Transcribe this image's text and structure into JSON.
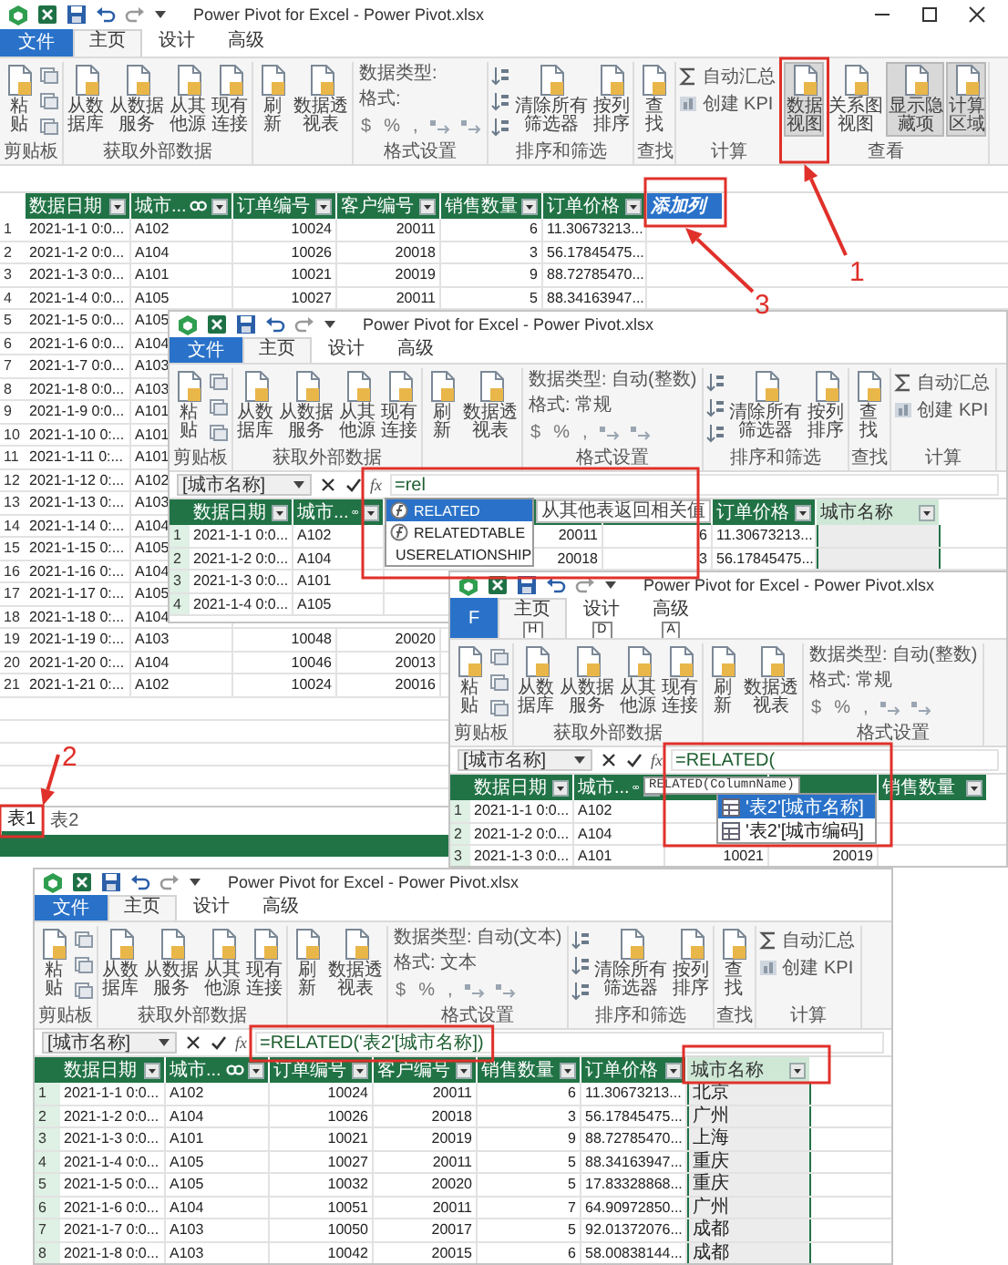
{
  "windows": [
    {
      "title": "Power Pivot for Excel - Power Pivot.xlsx",
      "window_controls": true,
      "tabs": [
        {
          "kind": "file",
          "label": "文件",
          "selected": false
        },
        {
          "label": "主页",
          "selected": true
        },
        {
          "label": "设计",
          "selected": false
        },
        {
          "label": "高级",
          "selected": false
        }
      ],
      "ribbon": [
        {
          "label": "剪贴板",
          "items": [
            {
              "kind": "large",
              "label": "粘贴"
            },
            {
              "kind": "icons"
            }
          ]
        },
        {
          "label": "获取外部数据",
          "items": [
            {
              "kind": "large",
              "label": "从数据库"
            },
            {
              "kind": "large",
              "label": "从数据服务"
            },
            {
              "kind": "large",
              "label": "从其他源"
            },
            {
              "kind": "large",
              "label": "现有连接"
            }
          ]
        },
        {
          "items": [
            {
              "kind": "large",
              "label": "刷新"
            },
            {
              "kind": "large",
              "label": "数据透视表"
            }
          ]
        },
        {
          "label": "格式设置",
          "items": [
            {
              "kind": "fields",
              "lines": [
                "数据类型:",
                "格式:"
              ],
              "symbols": [
                "$",
                "%",
                ","
              ]
            }
          ]
        },
        {
          "label": "排序和筛选",
          "items": [
            {
              "kind": "sort"
            },
            {
              "kind": "large",
              "label": "清除所有筛选器"
            },
            {
              "kind": "large",
              "label": "按列排序"
            }
          ]
        },
        {
          "label": "查找",
          "items": [
            {
              "kind": "large",
              "label": "查找"
            }
          ]
        },
        {
          "label": "计算",
          "items": [
            {
              "kind": "small",
              "labels": [
                "自动汇总",
                "创建 KPI"
              ]
            }
          ]
        },
        {
          "label": "查看",
          "items": [
            {
              "kind": "large",
              "label": "数据视图",
              "pressed": true
            },
            {
              "kind": "large",
              "label": "关系图视图",
              "pressed": false
            },
            {
              "kind": "large",
              "label": "显示隐藏项",
              "pressed": true
            },
            {
              "kind": "large",
              "label": "计算区域",
              "pressed": true
            }
          ]
        }
      ],
      "grid": {
        "columns": [
          {
            "label": "数据日期",
            "selected": false
          },
          {
            "label": "城市...",
            "kind": "related",
            "selected": false
          },
          {
            "label": "订单编号",
            "selected": false
          },
          {
            "label": "客户编号",
            "selected": false
          },
          {
            "label": "销售数量",
            "selected": false
          },
          {
            "label": "订单价格",
            "selected": false
          },
          {
            "label": "添加列",
            "kind": "add",
            "selected": true
          }
        ],
        "rows": [
          {
            "number": "1",
            "cells": [
              "2021-1-1 0:0...",
              "A102",
              "10024",
              "20011",
              "6",
              "11.30673213..."
            ]
          },
          {
            "number": "2",
            "cells": [
              "2021-1-2 0:0...",
              "A104",
              "10026",
              "20018",
              "3",
              "56.17845475..."
            ]
          },
          {
            "number": "3",
            "cells": [
              "2021-1-3 0:0...",
              "A101",
              "10021",
              "20019",
              "9",
              "88.72785470..."
            ]
          },
          {
            "number": "4",
            "cells": [
              "2021-1-4 0:0...",
              "A105",
              "10027",
              "20011",
              "5",
              "88.34163947..."
            ]
          },
          {
            "number": "5",
            "cells": [
              "2021-1-5 0:0...",
              "A105"
            ]
          },
          {
            "number": "6",
            "cells": [
              "2021-1-6 0:0...",
              "A104"
            ]
          },
          {
            "number": "7",
            "cells": [
              "2021-1-7 0:0...",
              "A103"
            ]
          },
          {
            "number": "8",
            "cells": [
              "2021-1-8 0:0...",
              "A103"
            ]
          },
          {
            "number": "9",
            "cells": [
              "2021-1-9 0:0...",
              "A101"
            ]
          },
          {
            "number": "10",
            "cells": [
              "2021-1-10 0:...",
              "A101"
            ]
          },
          {
            "number": "11",
            "cells": [
              "2021-1-11 0:...",
              "A101"
            ]
          },
          {
            "number": "12",
            "cells": [
              "2021-1-12 0:...",
              "A102"
            ]
          },
          {
            "number": "13",
            "cells": [
              "2021-1-13 0:...",
              "A103"
            ]
          },
          {
            "number": "14",
            "cells": [
              "2021-1-14 0:...",
              "A104"
            ]
          },
          {
            "number": "15",
            "cells": [
              "2021-1-15 0:...",
              "A105"
            ]
          },
          {
            "number": "16",
            "cells": [
              "2021-1-16 0:...",
              "A104"
            ]
          },
          {
            "number": "17",
            "cells": [
              "2021-1-17 0:...",
              "A105"
            ]
          },
          {
            "number": "18",
            "cells": [
              "2021-1-18 0:...",
              "A104"
            ]
          },
          {
            "number": "19",
            "cells": [
              "2021-1-19 0:...",
              "A103",
              "10048",
              "20020"
            ]
          },
          {
            "number": "20",
            "cells": [
              "2021-1-20 0:...",
              "A104",
              "10046",
              "20013"
            ]
          },
          {
            "number": "21",
            "cells": [
              "2021-1-21 0:...",
              "A102",
              "10024",
              "20016"
            ]
          }
        ]
      },
      "sheet_tabs": [
        {
          "label": "表1",
          "selected": true
        },
        {
          "label": "表2",
          "selected": false
        }
      ]
    },
    {
      "title": "Power Pivot for Excel - Power Pivot.xlsx",
      "tabs": [
        {
          "kind": "file",
          "label": "文件",
          "selected": false
        },
        {
          "label": "主页",
          "selected": true
        },
        {
          "label": "设计",
          "selected": false
        },
        {
          "label": "高级",
          "selected": false
        }
      ],
      "ribbon": [
        {
          "label": "剪贴板",
          "items": [
            {
              "kind": "large",
              "label": "粘贴"
            },
            {
              "kind": "icons"
            }
          ]
        },
        {
          "label": "获取外部数据",
          "items": [
            {
              "kind": "large",
              "label": "从数据库"
            },
            {
              "kind": "large",
              "label": "从数据服务"
            },
            {
              "kind": "large",
              "label": "从其他源"
            },
            {
              "kind": "large",
              "label": "现有连接"
            }
          ]
        },
        {
          "items": [
            {
              "kind": "large",
              "label": "刷新"
            },
            {
              "kind": "large",
              "label": "数据透视表"
            }
          ]
        },
        {
          "label": "格式设置",
          "items": [
            {
              "kind": "fields",
              "lines": [
                "数据类型: 自动(整数)",
                "格式: 常规"
              ],
              "symbols": [
                "$",
                "%",
                ","
              ]
            }
          ]
        },
        {
          "label": "排序和筛选",
          "items": [
            {
              "kind": "sort"
            },
            {
              "kind": "large",
              "label": "清除所有筛选器"
            },
            {
              "kind": "large",
              "label": "按列排序"
            }
          ]
        },
        {
          "label": "查找",
          "items": [
            {
              "kind": "large",
              "label": "查找"
            }
          ]
        },
        {
          "label": "计算",
          "items": [
            {
              "kind": "small",
              "labels": [
                "自动汇总",
                "创建 KPI"
              ]
            }
          ]
        }
      ],
      "formula_bar": {
        "name_box": "[城市名称]",
        "function_symbol": "fx",
        "formula": "=rel"
      },
      "autocomplete": {
        "tooltip": "从其他表返回相关值",
        "items": [
          {
            "label": "RELATED",
            "selected": true
          },
          {
            "label": "RELATEDTABLE",
            "selected": false
          },
          {
            "label": "USERELATIONSHIP",
            "selected": false
          }
        ]
      },
      "grid": {
        "columns": [
          {
            "label": "数据日期",
            "selected": false
          },
          {
            "label": "城市...",
            "kind": "related",
            "selected": false
          },
          {},
          {},
          {},
          {
            "label": "订单价格",
            "selected": false
          },
          {
            "label": "城市名称",
            "selected": true
          }
        ],
        "rows": [
          {
            "number": "1",
            "cells": [
              "2021-1-1 0:0...",
              "A102",
              null,
              "20011",
              "6",
              "11.30673213...",
              null
            ]
          },
          {
            "number": "2",
            "cells": [
              "2021-1-2 0:0...",
              "A104",
              null,
              "20018",
              "3",
              "56.17845475...",
              null
            ]
          },
          {
            "number": "3",
            "cells": [
              "2021-1-3 0:0...",
              "A101"
            ]
          },
          {
            "number": "4",
            "cells": [
              "2021-1-4 0:0...",
              "A105"
            ]
          }
        ]
      }
    },
    {
      "title": "Power Pivot for Excel - Power Pivot.xlsx",
      "tabs": [
        {
          "kind": "file",
          "label": "F",
          "selected": false
        },
        {
          "label": "主页",
          "keytip": "H",
          "selected": true
        },
        {
          "label": "设计",
          "keytip": "D",
          "selected": false
        },
        {
          "label": "高级",
          "keytip": "A",
          "selected": false
        }
      ],
      "ribbon": [
        {
          "label": "剪贴板",
          "items": [
            {
              "kind": "large",
              "label": "粘贴"
            },
            {
              "kind": "icons"
            }
          ]
        },
        {
          "label": "获取外部数据",
          "items": [
            {
              "kind": "large",
              "label": "从数据库"
            },
            {
              "kind": "large",
              "label": "从数据服务"
            },
            {
              "kind": "large",
              "label": "从其他源"
            },
            {
              "kind": "large",
              "label": "现有连接"
            }
          ]
        },
        {
          "items": [
            {
              "kind": "large",
              "label": "刷新"
            },
            {
              "kind": "large",
              "label": "数据透视表"
            }
          ]
        },
        {
          "label": "格式设置",
          "items": [
            {
              "kind": "fields",
              "lines": [
                "数据类型: 自动(整数)",
                "格式: 常规"
              ],
              "symbols": [
                "$",
                "%",
                ","
              ]
            }
          ]
        }
      ],
      "formula_bar": {
        "name_box": "[城市名称]",
        "function_symbol": "fx",
        "formula": "=RELATED("
      },
      "autocomplete": {
        "hint": "RELATED(ColumnName)",
        "items": [
          {
            "label": "'表2'[城市名称]",
            "selected": true
          },
          {
            "label": "'表2'[城市编码]",
            "selected": false
          }
        ]
      },
      "grid": {
        "columns": [
          {
            "label": "数据日期",
            "selected": false
          },
          {
            "label": "城市...",
            "kind": "related",
            "selected": false
          },
          {},
          {},
          {
            "label": "销售数量",
            "selected": false
          }
        ],
        "rows": [
          {
            "number": "1",
            "cells": [
              "2021-1-1 0:0...",
              "A102"
            ]
          },
          {
            "number": "2",
            "cells": [
              "2021-1-2 0:0...",
              "A104"
            ]
          },
          {
            "number": "3",
            "cells": [
              "2021-1-3 0:0...",
              "A101",
              "10021",
              "20019"
            ]
          }
        ]
      }
    },
    {
      "title": "Power Pivot for Excel - Power Pivot.xlsx",
      "tabs": [
        {
          "kind": "file",
          "label": "文件",
          "selected": false
        },
        {
          "label": "主页",
          "selected": true
        },
        {
          "label": "设计",
          "selected": false
        },
        {
          "label": "高级",
          "selected": false
        }
      ],
      "ribbon": [
        {
          "label": "剪贴板",
          "items": [
            {
              "kind": "large",
              "label": "粘贴"
            },
            {
              "kind": "icons"
            }
          ]
        },
        {
          "label": "获取外部数据",
          "items": [
            {
              "kind": "large",
              "label": "从数据库"
            },
            {
              "kind": "large",
              "label": "从数据服务"
            },
            {
              "kind": "large",
              "label": "从其他源"
            },
            {
              "kind": "large",
              "label": "现有连接"
            }
          ]
        },
        {
          "items": [
            {
              "kind": "large",
              "label": "刷新"
            },
            {
              "kind": "large",
              "label": "数据透视表"
            }
          ]
        },
        {
          "label": "格式设置",
          "items": [
            {
              "kind": "fields",
              "lines": [
                "数据类型: 自动(文本)",
                "格式: 文本"
              ],
              "symbols": [
                "$",
                "%",
                ","
              ]
            }
          ]
        },
        {
          "label": "排序和筛选",
          "items": [
            {
              "kind": "sort"
            },
            {
              "kind": "large",
              "label": "清除所有筛选器"
            },
            {
              "kind": "large",
              "label": "按列排序"
            }
          ]
        },
        {
          "label": "查找",
          "items": [
            {
              "kind": "large",
              "label": "查找"
            }
          ]
        },
        {
          "label": "计算",
          "items": [
            {
              "kind": "small",
              "labels": [
                "自动汇总",
                "创建 KPI"
              ]
            }
          ]
        }
      ],
      "formula_bar": {
        "name_box": "[城市名称]",
        "function_symbol": "fx",
        "formula": "=RELATED('表2'[城市名称])"
      },
      "grid": {
        "columns": [
          {
            "label": "数据日期",
            "selected": false
          },
          {
            "label": "城市...",
            "kind": "related",
            "selected": false
          },
          {
            "label": "订单编号",
            "selected": false
          },
          {
            "label": "客户编号",
            "selected": false
          },
          {
            "label": "销售数量",
            "selected": false
          },
          {
            "label": "订单价格",
            "selected": false
          },
          {
            "label": "城市名称",
            "selected": true
          }
        ],
        "rows": [
          {
            "number": "1",
            "cells": [
              "2021-1-1 0:0...",
              "A102",
              "10024",
              "20011",
              "6",
              "11.30673213...",
              "北京"
            ]
          },
          {
            "number": "2",
            "cells": [
              "2021-1-2 0:0...",
              "A104",
              "10026",
              "20018",
              "3",
              "56.17845475...",
              "广州"
            ]
          },
          {
            "number": "3",
            "cells": [
              "2021-1-3 0:0...",
              "A101",
              "10021",
              "20019",
              "9",
              "88.72785470...",
              "上海"
            ]
          },
          {
            "number": "4",
            "cells": [
              "2021-1-4 0:0...",
              "A105",
              "10027",
              "20011",
              "5",
              "88.34163947...",
              "重庆"
            ]
          },
          {
            "number": "5",
            "cells": [
              "2021-1-5 0:0...",
              "A105",
              "10032",
              "20020",
              "5",
              "17.83328868...",
              "重庆"
            ]
          },
          {
            "number": "6",
            "cells": [
              "2021-1-6 0:0...",
              "A104",
              "10051",
              "20011",
              "7",
              "64.90972850...",
              "广州"
            ]
          },
          {
            "number": "7",
            "cells": [
              "2021-1-7 0:0...",
              "A103",
              "10050",
              "20017",
              "5",
              "92.01372076...",
              "成都"
            ]
          },
          {
            "number": "8",
            "cells": [
              "2021-1-8 0:0...",
              "A103",
              "10042",
              "20015",
              "6",
              "58.00838144...",
              "成都"
            ]
          }
        ]
      }
    }
  ],
  "callouts": [
    "1",
    "2",
    "3"
  ]
}
